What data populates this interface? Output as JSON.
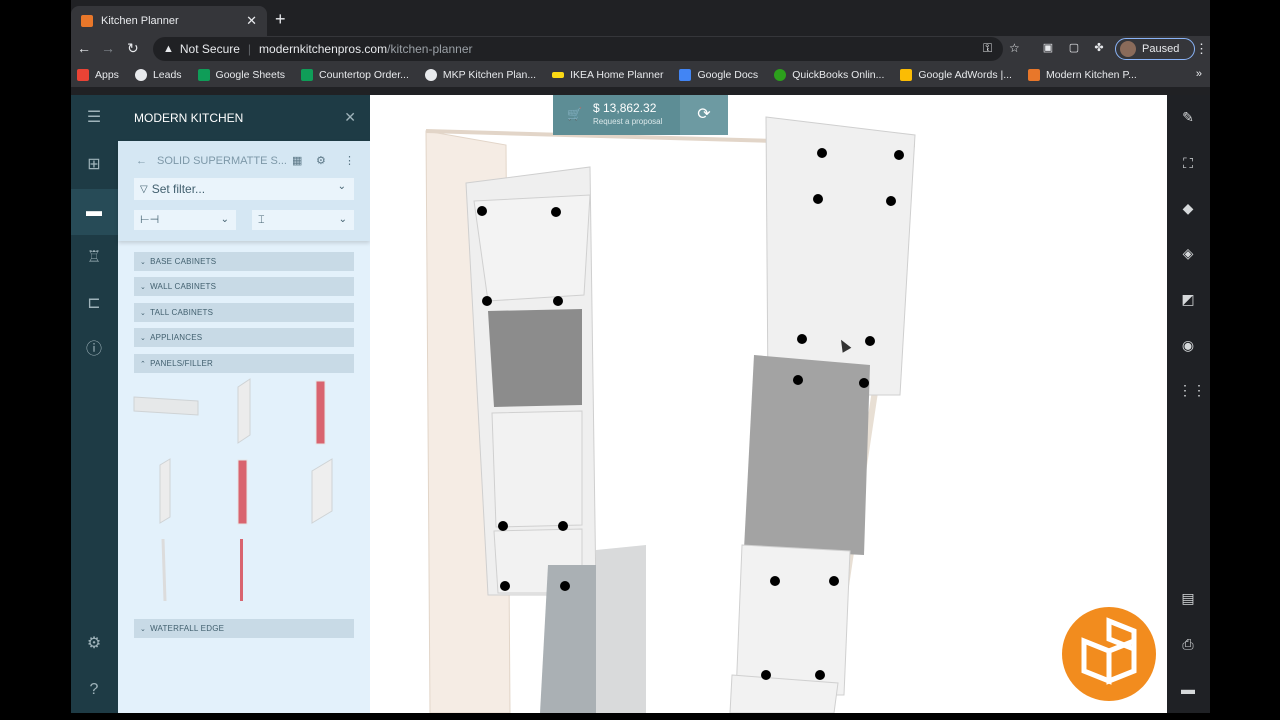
{
  "browser": {
    "tab_title": "Kitchen Planner",
    "tab_close": "✕",
    "new_tab": "+",
    "security_label": "Not Secure",
    "url_domain": "modernkitchenpros.com",
    "url_path": "/kitchen-planner",
    "profile_status": "Paused",
    "bookmarks": [
      {
        "label": "Apps",
        "color": "#ea4335"
      },
      {
        "label": "Leads",
        "color": "#ffffff"
      },
      {
        "label": "Google Sheets",
        "color": "#0f9d58"
      },
      {
        "label": "Countertop Order...",
        "color": "#0f9d58"
      },
      {
        "label": "MKP Kitchen Plan...",
        "color": "#ffffff"
      },
      {
        "label": "IKEA Home Planner",
        "color": "#fbd914"
      },
      {
        "label": "Google Docs",
        "color": "#4285f4"
      },
      {
        "label": "QuickBooks Onlin...",
        "color": "#2ca01c"
      },
      {
        "label": "Google AdWords |...",
        "color": "#fbbc04"
      },
      {
        "label": "Modern Kitchen P...",
        "color": "#e8772a"
      }
    ],
    "bookmarks_more": "»"
  },
  "panel": {
    "title": "MODERN KITCHEN",
    "close": "✕",
    "breadcrumb": "SOLID SUPERMATTE S...",
    "filter_placeholder": "Set filter...",
    "categories": [
      {
        "label": "BASE CABINETS",
        "expanded": false
      },
      {
        "label": "WALL CABINETS",
        "expanded": false
      },
      {
        "label": "TALL CABINETS",
        "expanded": false
      },
      {
        "label": "APPLIANCES",
        "expanded": false
      },
      {
        "label": "PANELS/FILLER",
        "expanded": true
      },
      {
        "label": "WATERFALL EDGE",
        "expanded": false
      }
    ]
  },
  "viewport": {
    "price": "$ 13,862.32",
    "request_label": "Request a proposal"
  },
  "colors": {
    "rail": "#1e3b45",
    "panel_bg": "#e3f1fb",
    "price_bar": "#5d8d95",
    "logo": "#f28c1e",
    "accent_red": "#d9646f"
  }
}
